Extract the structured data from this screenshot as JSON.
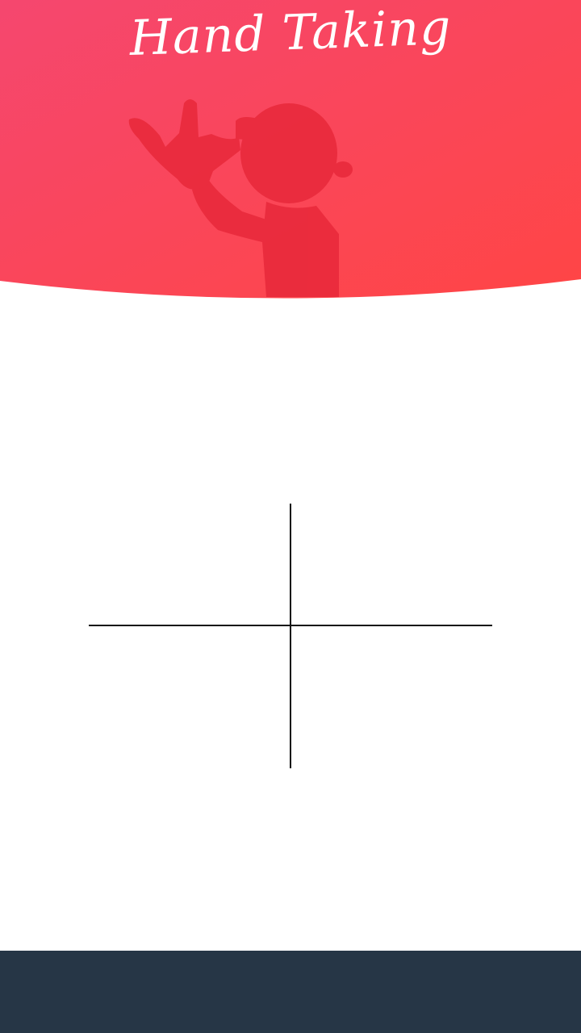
{
  "header": {
    "title": "Hand Taking",
    "gradient_start": "#f5476f",
    "gradient_end": "#ff4545",
    "silhouette_color": "#e8283a",
    "illustration": "kid-thumbs-to-nose-silhouette"
  },
  "canvas": {
    "background": "#ffffff",
    "line_color": "#111111",
    "icon": "crosshair"
  },
  "bottom_bar": {
    "color": "#263646"
  }
}
